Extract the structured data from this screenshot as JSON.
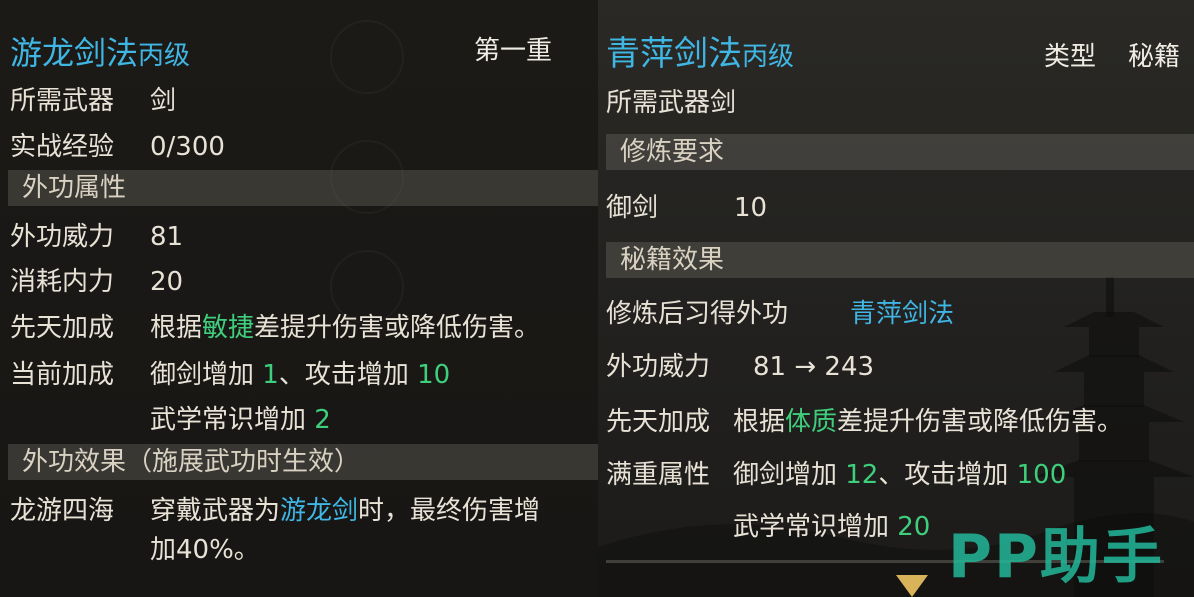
{
  "left": {
    "title": "游龙剑法",
    "grade": "丙级",
    "level": "第一重",
    "weapon_label": "所需武器",
    "weapon_value": "剑",
    "exp_label": "实战经验",
    "exp_value": "0/300",
    "section_attr": "外功属性",
    "power_label": "外功威力",
    "power_value": "81",
    "cost_label": "消耗内力",
    "cost_value": "20",
    "innate_label": "先天加成",
    "innate_pre": "根据",
    "innate_key": "敏捷",
    "innate_post": "差提升伤害或降低伤害。",
    "current_label": "当前加成",
    "cur_a": "御剑增加 ",
    "cur_a_val": "1",
    "cur_b": "、攻击增加 ",
    "cur_b_val": "10",
    "cur_c": "武学常识增加 ",
    "cur_c_val": "2",
    "section_effect": "外功效果（施展武功时生效）",
    "effect_label": "龙游四海",
    "effect_pre": "穿戴武器为",
    "effect_key": "游龙剑",
    "effect_post": "时，最终伤害增",
    "effect_line2": "加40%。"
  },
  "right": {
    "title": "青萍剑法",
    "grade": "丙级",
    "type_label": "类型",
    "type_value": "秘籍",
    "weapon_line": "所需武器剑",
    "section_req": "修炼要求",
    "req_label": "御剑",
    "req_value": "10",
    "section_effect": "秘籍效果",
    "learn_label": "修炼后习得外功",
    "learn_value": "青萍剑法",
    "power_label": "外功威力",
    "power_value": "81 → 243",
    "innate_label": "先天加成",
    "innate_pre": "根据",
    "innate_key": "体质",
    "innate_post": "差提升伤害或降低伤害。",
    "full_label": "满重属性",
    "full_a": "御剑增加 ",
    "full_a_val": "12",
    "full_b": "、攻击增加 ",
    "full_b_val": "100",
    "full_c": "武学常识增加 ",
    "full_c_val": "20"
  },
  "watermark": "PP助手",
  "colors": {
    "title_cyan": "#3fb6e4",
    "value_green": "#3fcf7c",
    "watermark": "#22b89a",
    "arrow_gold": "#d9b35a"
  }
}
